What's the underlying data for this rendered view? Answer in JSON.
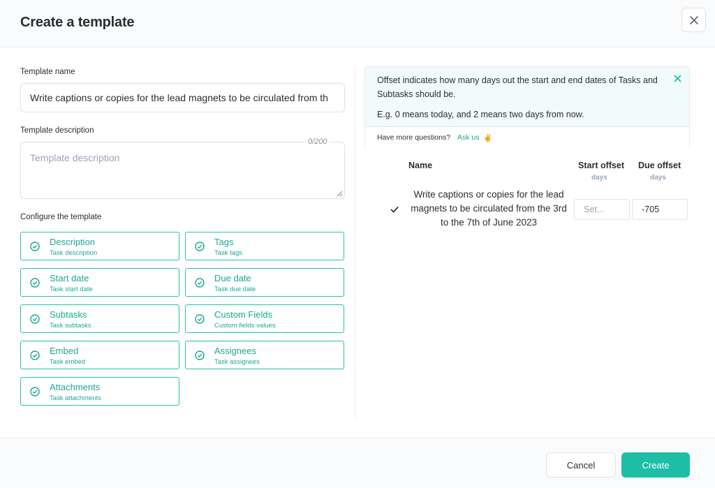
{
  "header": {
    "title": "Create a template",
    "close_icon": "close-icon"
  },
  "form": {
    "name_label": "Template name",
    "name_value": "Write captions or copies for the lead magnets to be circulated from th",
    "description_label": "Template description",
    "description_placeholder": "Template description",
    "description_counter": "0/200",
    "configure_label": "Configure the template"
  },
  "options": [
    {
      "title": "Description",
      "subtitle": "Task description",
      "checked": true
    },
    {
      "title": "Tags",
      "subtitle": "Task tags",
      "checked": true
    },
    {
      "title": "Start date",
      "subtitle": "Task start date",
      "checked": true
    },
    {
      "title": "Due date",
      "subtitle": "Task due date",
      "checked": true
    },
    {
      "title": "Subtasks",
      "subtitle": "Task subtasks",
      "checked": true
    },
    {
      "title": "Custom Fields",
      "subtitle": "Custom fields values",
      "checked": true
    },
    {
      "title": "Embed",
      "subtitle": "Task embed",
      "checked": true
    },
    {
      "title": "Assignees",
      "subtitle": "Task assignees",
      "checked": true
    },
    {
      "title": "Attachments",
      "subtitle": "Task attachments",
      "checked": true
    }
  ],
  "info": {
    "text": "Offset indicates how many days out the start and end dates of Tasks and Subtasks should be.",
    "example": "E.g. 0 means today, and 2 means two days from now.",
    "questions": "Have more questions?",
    "ask_link": "Ask us",
    "emoji": "✌️"
  },
  "table": {
    "col_name": "Name",
    "col_start": "Start offset",
    "col_start_unit": "days",
    "col_due": "Due offset",
    "col_due_unit": "days",
    "row": {
      "name": "Write captions or copies for the lead magnets to be circulated from the 3rd to the 7th of June 2023",
      "start_placeholder": "Set...",
      "due_value": "-705"
    }
  },
  "footer": {
    "cancel_label": "Cancel",
    "create_label": "Create"
  },
  "colors": {
    "accent": "#1cbfa6",
    "accent_text": "#1aa792",
    "info_bg": "#f0fbfa"
  }
}
